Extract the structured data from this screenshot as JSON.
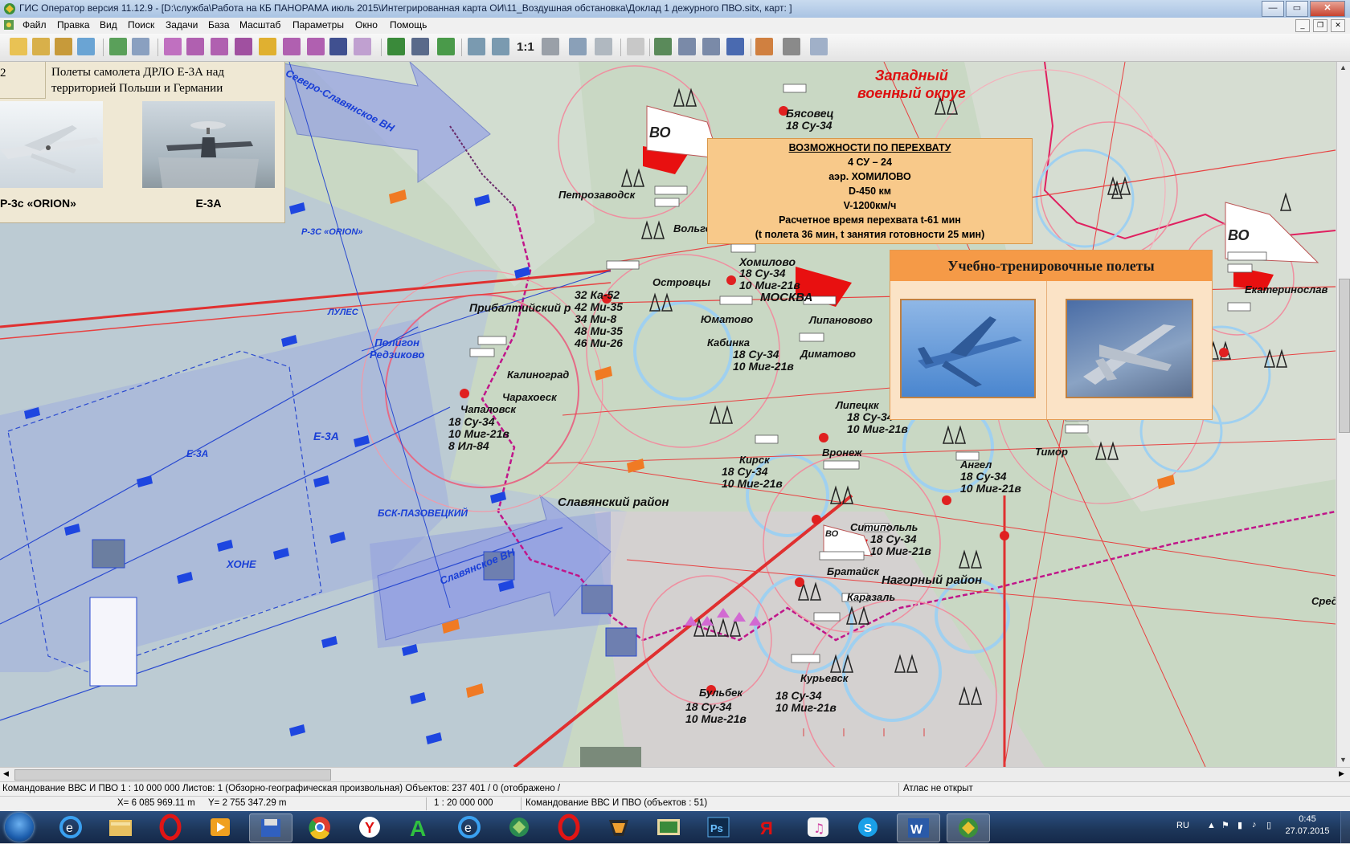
{
  "window": {
    "title": "ГИС Оператор версия 11.12.9 - [D:\\служба\\Работа на КБ ПАНОРАМА июль 2015\\Интегрированная карта ОИ\\11_Воздушная обстановка\\Доклад 1 дежурного ПВО.sitx, карт: ]",
    "buttons": {
      "minimize": "—",
      "maximize": "▭",
      "close": "✕"
    }
  },
  "menu": [
    "Файл",
    "Правка",
    "Вид",
    "Поиск",
    "Задачи",
    "База",
    "Масштаб",
    "Параметры",
    "Окно",
    "Помощь"
  ],
  "toolbar": {
    "scale_label": "1:1",
    "icons": [
      "open-folder-icon",
      "open-map-icon",
      "open-network-icon",
      "add-layer-icon",
      "layers-icon",
      "list-icon",
      "select-icon",
      "select-text-icon",
      "select-area-icon",
      "select-polygon-icon",
      "select-rect-icon",
      "edit-select-icon",
      "list-objects-icon",
      "clear-select-icon",
      "map-view-icon",
      "route-icon",
      "lightning-icon",
      "zoom-out-icon",
      "zoom-in-icon",
      "zoom-rect-icon",
      "check-icon",
      "back-icon",
      "pointer-icon",
      "table-icon",
      "text-icon",
      "object-icon",
      "label-icon",
      "paint-icon",
      "print-icon",
      "help-icon"
    ]
  },
  "left_panel": {
    "number": "2",
    "title": "Полеты самолета ДРЛО Е-3А над территорией Польши и Германии",
    "caption_left": "Р-3с «ORION»",
    "caption_right": "Е-3А"
  },
  "intercept_popup": {
    "header": "ВОЗМОЖНОСТИ ПО ПЕРЕХВАТУ",
    "lines": [
      "4 СУ – 24",
      "аэр. ХОМИЛОВО",
      "D-450 км",
      "V-1200км/ч",
      "Расчетное время перехвата t-61 мин",
      "(t полета 36 мин, t занятия готовности 25 мин)"
    ]
  },
  "training_popup": {
    "header": "Учебно-тренировочные полеты"
  },
  "map_labels": {
    "western_district": "Западный\nвоенный округ",
    "vo1": "ВО",
    "vo2": "ВО",
    "vo3": "ВО",
    "bjasovec": "Бясовец",
    "bjasovec_forces": "18 Су-34",
    "petrozavodsk": "Петрозаводск",
    "volgograd": "Вольгоградо",
    "ostrovcy": "Островцы",
    "khomilovo": "Хомилово",
    "khomilovo_forces": "18 Су-34\n10 Миг-21в",
    "moskva": "МОСКВА",
    "yumatovo": "Юматово",
    "lipanovovo": "Липановово",
    "kabinka": "Кабинка",
    "kabinka_forces": "18 Су-34\n10 Миг-21в",
    "dimatovo": "Диматово",
    "baltic_region": "Прибалтийский р",
    "baltic_forces": "32 Ка-52\n42 Ми-35\n34 Ми-8\n48 Ми-35\n46 Ми-26",
    "kalinograd": "Калиноград",
    "charakhovsk": "Чарахоеск",
    "chalalovsk": "Чапаловск",
    "chalalovsk_forces": "18 Су-34\n10 Миг-21в\n8 Ил-84",
    "polygon": "Полигон\nРедзиково",
    "orion_route": "Р-3С «ORION»",
    "lules": "ЛУЛЕС",
    "north_slav": "Северо-Славянское ВН",
    "e3a_left": "Е-3А",
    "e3a_map": "Е-3А",
    "slav_region": "Славянский район",
    "slav_vn": "Славянское ВН",
    "hone": "ХОНЕ",
    "bsk": "БСК-ПАЗОВЕЦКИЙ",
    "ekaterinoslav": "Екатеринослав",
    "lipetsk": "Липецкк",
    "lipetsk_forces": "18 Су-34\n10 Миг-21в",
    "kirsk": "Кирск",
    "kirsk_forces": "18 Су-34\n10 Миг-21в",
    "voronezh": "Вронеж",
    "angel": "Ангел",
    "angel_forces": "18 Су-34\n10 Миг-21в",
    "timor": "Тимор",
    "sitipol": "Ситипольль",
    "sitipol_forces": "18 Су-34\n10 Миг-21в",
    "bratajsk": "Братайск",
    "karazal": "Каразаль",
    "nagorny": "Нагорный район",
    "bulbek": "Бульбек",
    "bulbek_forces": "18 Су-34\n10 Миг-21в",
    "kuryevsk": "Курьевск",
    "kuryevsk_forces": "18 Су-34\n10 Миг-21в",
    "sred": "Сред"
  },
  "status": {
    "line1_left": "Командование ВВС И ПВО  1 : 10 000 000  Листов: 1   (Обзорно-географическая произвольная)  Объектов: 237 401 / 0 (отображено /",
    "line1_right": "Атлас не открыт",
    "coord_x": "X= 6 085 969.11 m",
    "coord_y": "Y= 2 755 347.29 m",
    "scale": "1 : 20 000 000",
    "layer": "Командование ВВС И ПВО   (объектов : 51)"
  },
  "taskbar": {
    "apps": [
      "ie-icon",
      "explorer-icon",
      "opera-icon",
      "media-icon",
      "save-icon",
      "chrome-icon",
      "yandex-browser-icon",
      "a-icon",
      "ie2-icon",
      "globe-icon",
      "opera2-icon",
      "winamp-icon",
      "picture-icon",
      "photoshop-icon",
      "yandex-icon",
      "itunes-icon",
      "skype-icon",
      "word-icon",
      "gis-operator-icon"
    ],
    "tray_lang": "RU",
    "clock_time": "0:45",
    "clock_date": "27.07.2015"
  }
}
